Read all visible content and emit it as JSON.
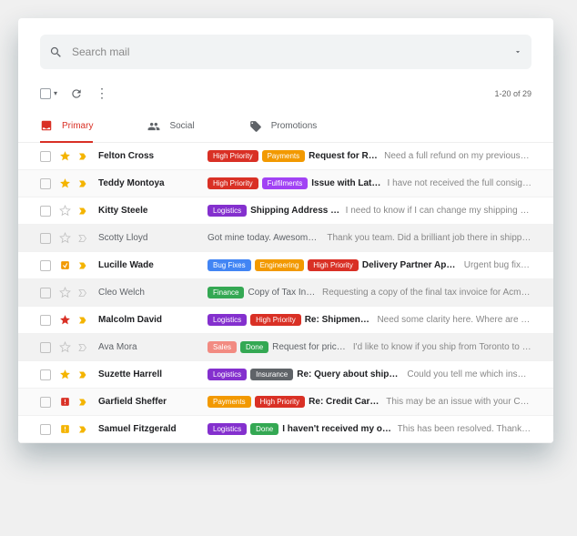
{
  "search": {
    "placeholder": "Search mail"
  },
  "toolbar": {
    "count": "1-20 of 29"
  },
  "tabs": [
    {
      "label": "Primary",
      "active": true,
      "icon": "inbox"
    },
    {
      "label": "Social",
      "active": false,
      "icon": "people"
    },
    {
      "label": "Promotions",
      "active": false,
      "icon": "tag"
    }
  ],
  "labelColors": {
    "High Priority": "#d93025",
    "Payments": "#f29900",
    "Fulfilments": "#a142f4",
    "Logistics": "#8430ce",
    "Bug Fixes": "#4285f4",
    "Engineering": "#f29900",
    "Finance": "#34a853",
    "Sales": "#f28b82",
    "Done": "#34a853",
    "Insurance": "#5f6368"
  },
  "emails": [
    {
      "unread": true,
      "star": "gold",
      "importance": "yellow",
      "sender": "Felton Cross",
      "labels": [
        "High Priority",
        "Payments"
      ],
      "subject": "Request for Refund",
      "snippet": "Need a full refund on my previous order of..."
    },
    {
      "unread": true,
      "star": "gold",
      "importance": "yellow",
      "sender": "Teddy Montoya",
      "labels": [
        "High Priority",
        "Fulfilments"
      ],
      "subject": "Issue with Latest Order",
      "snippet": "I have not received the full consignment of orders..."
    },
    {
      "unread": true,
      "star": "none",
      "importance": "yellow",
      "sender": "Kitty Steele",
      "labels": [
        "Logistics"
      ],
      "subject": "Shipping Address Change",
      "snippet": "I need to know if I can change my shipping address from..."
    },
    {
      "unread": false,
      "star": "none",
      "importance": "none",
      "sender": "Scotty Lloyd",
      "labels": [],
      "subject": "Got mine today. Awesome stuff.",
      "snippet": "Thank you team. Did a brilliant job there in shipping my..."
    },
    {
      "unread": true,
      "star": "orange-square",
      "importance": "yellow",
      "sender": "Lucille Wade",
      "labels": [
        "Bug Fixes",
        "Engineering",
        "High Priority"
      ],
      "subject": "Delivery Partner App Notification Sync",
      "snippet": "Urgent bug fix: Partner app..."
    },
    {
      "unread": false,
      "star": "none",
      "importance": "none",
      "sender": "Cleo Welch",
      "labels": [
        "Finance"
      ],
      "subject": "Copy of Tax Invoice",
      "snippet": "Requesting a copy of the final tax invoice for Acme Inc. for..."
    },
    {
      "unread": true,
      "star": "red",
      "importance": "yellow",
      "sender": "Malcolm David",
      "labels": [
        "Logistics",
        "High Priority"
      ],
      "subject": "Re: Shipment Delayed?",
      "snippet": "Need some clarity here. Where are my orders? Tracking..."
    },
    {
      "unread": false,
      "star": "none",
      "importance": "none",
      "sender": "Ava Mora",
      "labels": [
        "Sales",
        "Done"
      ],
      "subject": "Request for price quote",
      "snippet": "I'd like to know if you ship from Toronto to Berlin by air..."
    },
    {
      "unread": true,
      "star": "gold",
      "importance": "yellow",
      "sender": "Suzette Harrell",
      "labels": [
        "Logistics",
        "Insurance"
      ],
      "subject": "Re: Query about shipping insurance",
      "snippet": "Could you tell me which insurance provider I..."
    },
    {
      "unread": true,
      "star": "red-alert",
      "importance": "yellow",
      "sender": "Garfield Sheffer",
      "labels": [
        "Payments",
        "High Priority"
      ],
      "subject": "Re: Credit Card Declined",
      "snippet": "This may be an issue with your Credit Card provider..."
    },
    {
      "unread": true,
      "star": "yellow-alert",
      "importance": "yellow",
      "sender": "Samuel Fitzgerald",
      "labels": [
        "Logistics",
        "Done"
      ],
      "subject": "I haven't received my order",
      "snippet": "This has been resolved. Thank you."
    }
  ]
}
